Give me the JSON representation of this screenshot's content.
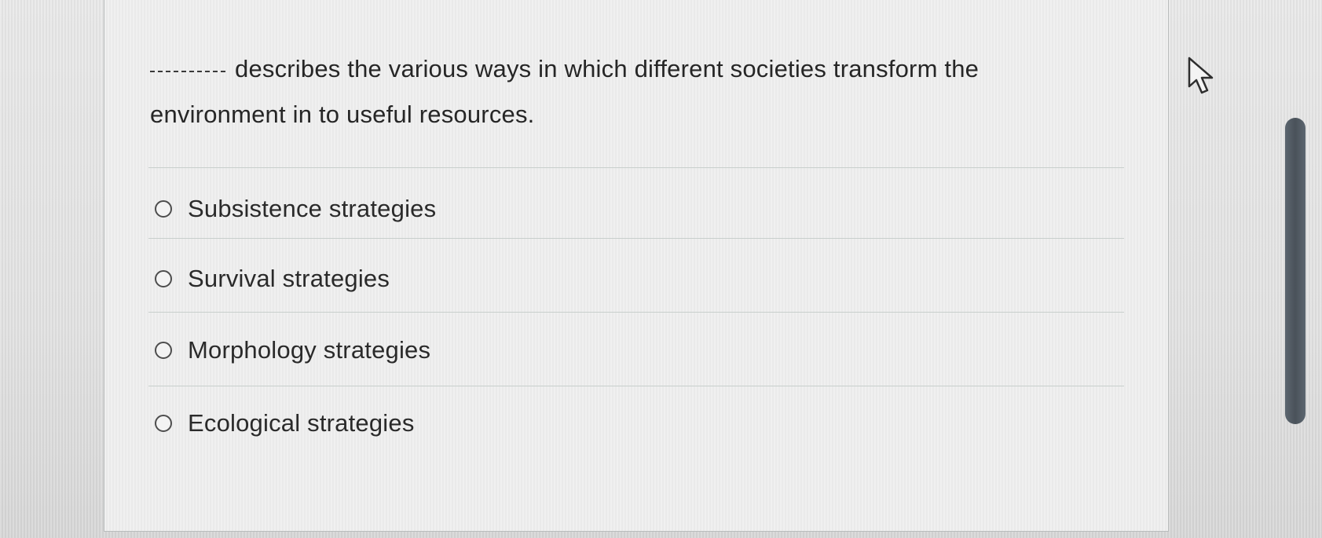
{
  "question": {
    "stem": "describes the various ways in which different societies transform the environment in to useful resources.",
    "blank_icon": "fill-in-blank-line"
  },
  "options": [
    {
      "label": "Subsistence strategies",
      "selected": false
    },
    {
      "label": "Survival strategies",
      "selected": false
    },
    {
      "label": "Morphology strategies",
      "selected": false
    },
    {
      "label": "Ecological strategies",
      "selected": false
    }
  ],
  "icons": {
    "cursor": "arrow-pointer-icon",
    "radio": "radio-unselected-icon"
  },
  "colors": {
    "text": "#262626",
    "scrollbar": "#525b63",
    "card_border": "#b9bcbc"
  }
}
